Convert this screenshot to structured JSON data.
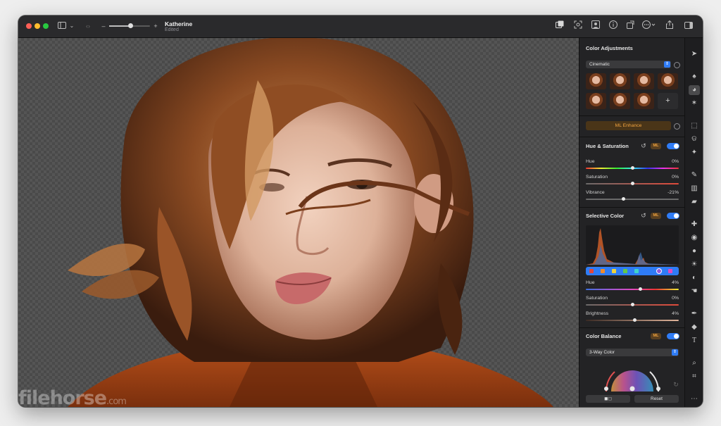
{
  "window": {
    "title": "Katherine",
    "subtitle": "Edited",
    "traffic_colors": [
      "#ff5f57",
      "#febc2e",
      "#28c840"
    ]
  },
  "toolbar": {
    "icons": [
      "sidebar-icon",
      "chevron-down-icon",
      "back-forward-icon",
      "zoom-out-icon",
      "zoom-slider",
      "zoom-in-icon",
      "compare-icon",
      "face-detect-icon",
      "image-info-icon",
      "info-icon",
      "share-icon",
      "more-icon",
      "export-icon",
      "inspector-toggle-icon"
    ]
  },
  "panel": {
    "title": "Color Adjustments",
    "preset": "Cinematic",
    "add_preset": "+",
    "ml_enhance": "ML Enhance",
    "hue_saturation": {
      "title": "Hue & Saturation",
      "ml_badge": "ML",
      "rows": [
        {
          "label": "Hue",
          "value": "0%",
          "level": 0.5
        },
        {
          "label": "Saturation",
          "value": "0%",
          "level": 0.5
        },
        {
          "label": "Vibrance",
          "value": "-21%",
          "level": 0.4
        }
      ]
    },
    "selective_color": {
      "title": "Selective Color",
      "ml_badge": "ML",
      "swatches": [
        "#e4463a",
        "#ef8b2c",
        "#efd33a",
        "#61c94a",
        "#3fd3c9",
        "#2f7cf6",
        "#9b59d6",
        "#e24ac0"
      ],
      "rows": [
        {
          "label": "Hue",
          "value": "4%",
          "level": 0.58
        },
        {
          "label": "Saturation",
          "value": "0%",
          "level": 0.5
        },
        {
          "label": "Brightness",
          "value": "4%",
          "level": 0.52
        }
      ]
    },
    "color_balance": {
      "title": "Color Balance",
      "ml_badge": "ML",
      "mode": "3-Way Color"
    },
    "footer": {
      "compare_label": "◼◻",
      "reset_label": "Reset"
    }
  },
  "watermark": {
    "brand": "filehorse",
    "suffix": ".com"
  }
}
